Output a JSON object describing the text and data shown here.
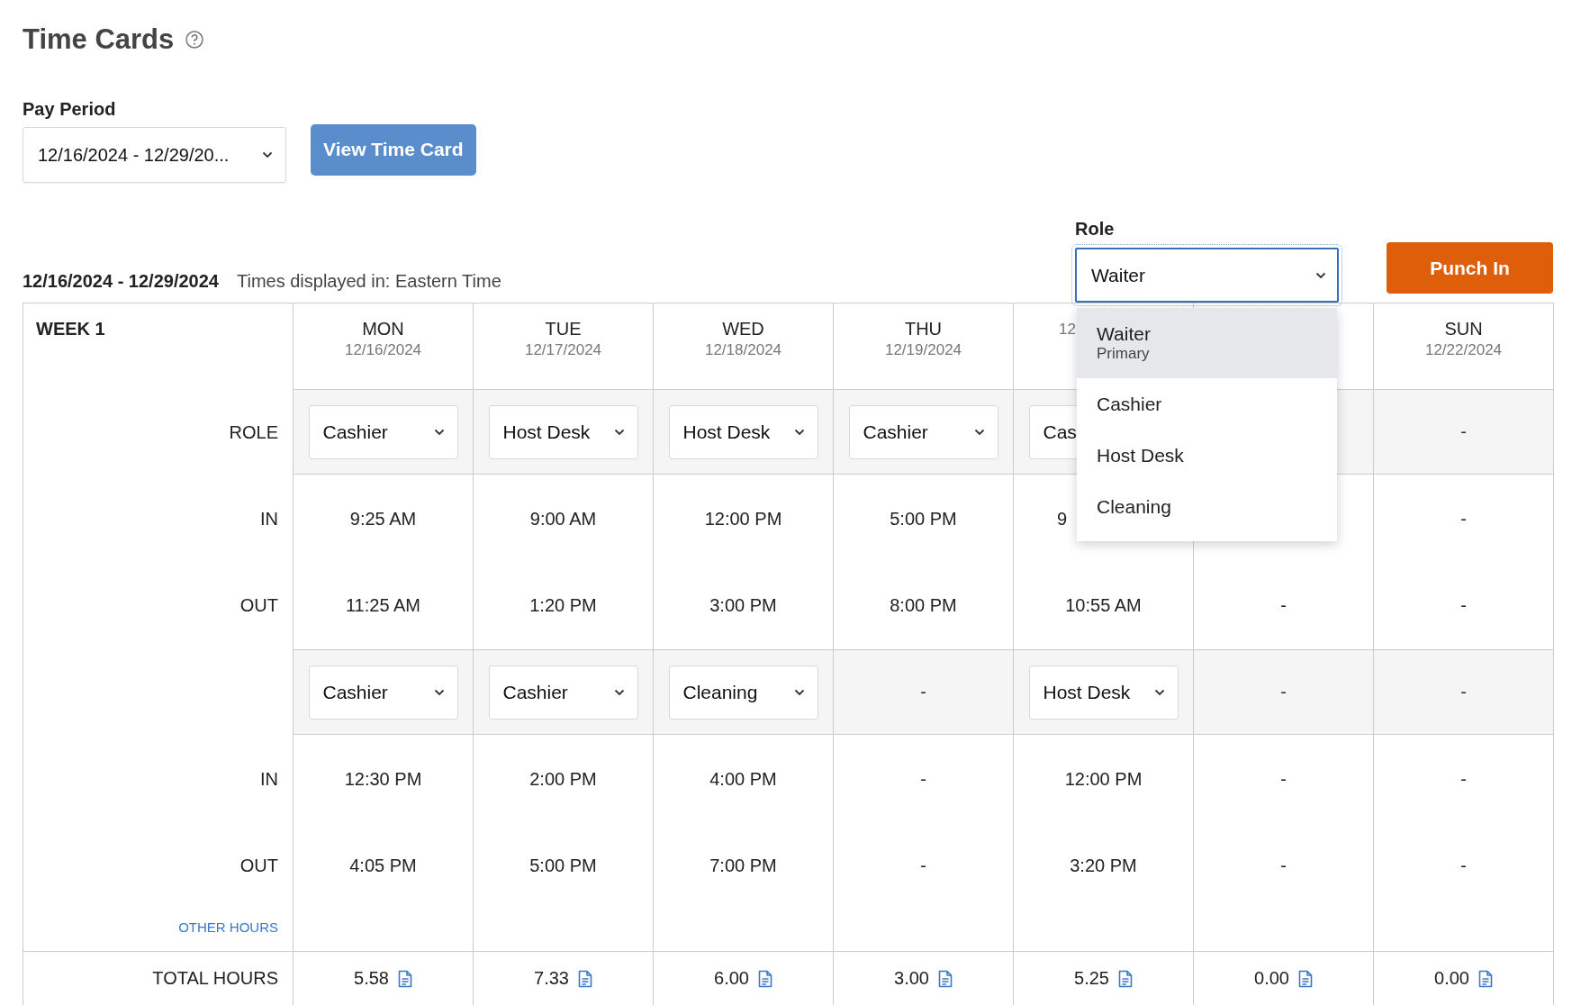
{
  "title": "Time Cards",
  "pay_period": {
    "label": "Pay Period",
    "value": "12/16/2024 - 12/29/20..."
  },
  "view_button": "View Time Card",
  "range": "12/16/2024 - 12/29/2024",
  "timezone_note": "Times displayed in: Eastern Time",
  "role": {
    "label": "Role",
    "value": "Waiter",
    "expanded": true,
    "options": [
      {
        "name": "Waiter",
        "note": "Primary",
        "selected": true
      },
      {
        "name": "Cashier",
        "selected": false
      },
      {
        "name": "Host Desk",
        "selected": false
      },
      {
        "name": "Cleaning",
        "selected": false
      }
    ]
  },
  "punch_button": "Punch In",
  "week": {
    "label": "WEEK 1",
    "row_labels": {
      "role": "ROLE",
      "in_1": "IN",
      "out_1": "OUT",
      "in_2": "IN",
      "out_2": "OUT",
      "other": "OTHER HOURS",
      "total": "TOTAL HOURS"
    },
    "days": [
      {
        "day": "MON",
        "date": "12/16/2024",
        "cut_off": false,
        "shifts": [
          {
            "role": {
              "kind": "select",
              "value": "Cashier"
            },
            "in": "9:25 AM",
            "out": "11:25 AM"
          },
          {
            "role": {
              "kind": "select",
              "value": "Cashier"
            },
            "in": "12:30 PM",
            "out": "4:05 PM"
          }
        ],
        "total": "5.58"
      },
      {
        "day": "TUE",
        "date": "12/17/2024",
        "cut_off": false,
        "shifts": [
          {
            "role": {
              "kind": "select",
              "value": "Host Desk"
            },
            "in": "9:00 AM",
            "out": "1:20 PM"
          },
          {
            "role": {
              "kind": "select",
              "value": "Cashier"
            },
            "in": "2:00 PM",
            "out": "5:00 PM"
          }
        ],
        "total": "7.33"
      },
      {
        "day": "WED",
        "date": "12/18/2024",
        "cut_off": false,
        "shifts": [
          {
            "role": {
              "kind": "select",
              "value": "Host Desk"
            },
            "in": "12:00 PM",
            "out": "3:00 PM"
          },
          {
            "role": {
              "kind": "select",
              "value": "Cleaning"
            },
            "in": "4:00 PM",
            "out": "7:00 PM"
          }
        ],
        "total": "6.00"
      },
      {
        "day": "THU",
        "date": "12/19/2024",
        "cut_off": false,
        "shifts": [
          {
            "role": {
              "kind": "select",
              "value": "Cashier"
            },
            "in": "5:00 PM",
            "out": "8:00 PM"
          },
          {
            "role": {
              "kind": "empty",
              "value": "-"
            },
            "in": "-",
            "out": "-"
          }
        ],
        "total": "3.00"
      },
      {
        "date": "12",
        "cut_off": true,
        "shifts": [
          {
            "role": {
              "kind": "select",
              "value": "Cas"
            },
            "in": "9",
            "out": "10:55 AM"
          },
          {
            "role": {
              "kind": "select",
              "value": "Host Desk"
            },
            "in": "12:00 PM",
            "out": "3:20 PM"
          }
        ],
        "total": "5.25"
      },
      {
        "shifts": [
          {
            "out": "-"
          },
          {
            "role": {
              "kind": "empty",
              "value": "-"
            },
            "in": "-",
            "out": "-"
          }
        ],
        "total": "0.00"
      },
      {
        "day": "SUN",
        "date": "12/22/2024",
        "cut_off": false,
        "shifts": [
          {
            "role": {
              "kind": "empty",
              "value": "-"
            },
            "in": "-",
            "out": "-"
          },
          {
            "role": {
              "kind": "empty",
              "value": "-"
            },
            "in": "-",
            "out": "-"
          }
        ],
        "total": "0.00"
      }
    ]
  }
}
